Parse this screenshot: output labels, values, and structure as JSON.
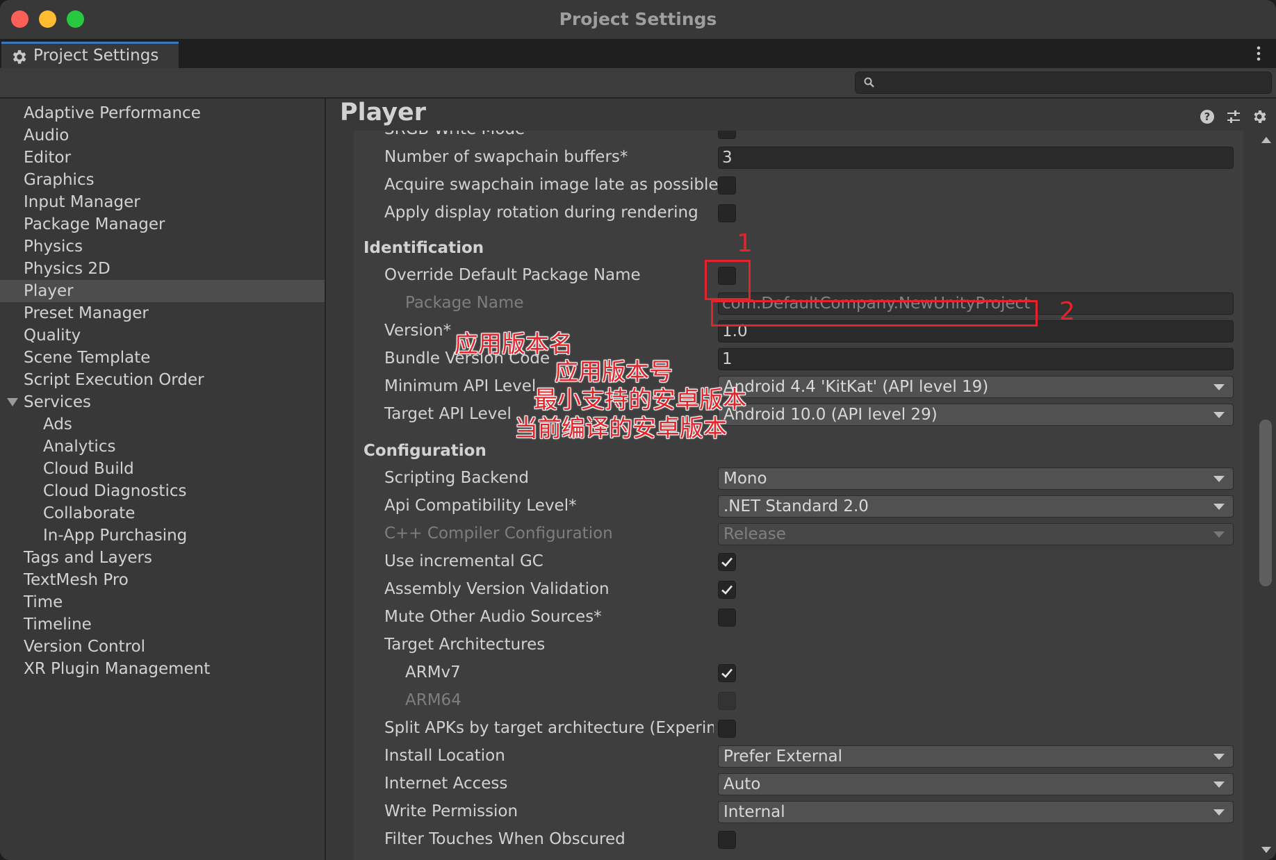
{
  "window": {
    "title": "Project Settings"
  },
  "tab": {
    "label": "Project Settings"
  },
  "search": {
    "placeholder": "",
    "value": ""
  },
  "sidebar": {
    "items": [
      {
        "label": "Adaptive Performance"
      },
      {
        "label": "Audio"
      },
      {
        "label": "Editor"
      },
      {
        "label": "Graphics"
      },
      {
        "label": "Input Manager"
      },
      {
        "label": "Package Manager"
      },
      {
        "label": "Physics"
      },
      {
        "label": "Physics 2D"
      },
      {
        "label": "Player",
        "selected": true
      },
      {
        "label": "Preset Manager"
      },
      {
        "label": "Quality"
      },
      {
        "label": "Scene Template"
      },
      {
        "label": "Script Execution Order"
      },
      {
        "label": "Services",
        "expanded": true
      },
      {
        "label": "Ads"
      },
      {
        "label": "Analytics"
      },
      {
        "label": "Cloud Build"
      },
      {
        "label": "Cloud Diagnostics"
      },
      {
        "label": "Collaborate"
      },
      {
        "label": "In-App Purchasing"
      },
      {
        "label": "Tags and Layers"
      },
      {
        "label": "TextMesh Pro"
      },
      {
        "label": "Time"
      },
      {
        "label": "Timeline"
      },
      {
        "label": "Version Control"
      },
      {
        "label": "XR Plugin Management"
      }
    ]
  },
  "panel": {
    "title": "Player",
    "rows": [
      {
        "label": "SRGB Write Mode*",
        "type": "checkbox",
        "checked": false
      },
      {
        "label": "Number of swapchain buffers*",
        "type": "field",
        "value": "3"
      },
      {
        "label": "Acquire swapchain image late as possible*",
        "type": "checkbox",
        "checked": false
      },
      {
        "label": "Apply display rotation during rendering",
        "type": "checkbox",
        "checked": false
      },
      {
        "label": "Identification",
        "type": "section"
      },
      {
        "label": "Override Default Package Name",
        "type": "checkbox",
        "checked": false
      },
      {
        "label": "Package Name",
        "type": "field",
        "value": "com.DefaultCompany.NewUnityProject",
        "disabled": true
      },
      {
        "label": "Version*",
        "type": "field",
        "value": "1.0"
      },
      {
        "label": "Bundle Version Code",
        "type": "field",
        "value": "1"
      },
      {
        "label": "Minimum API Level",
        "type": "dropdown",
        "value": "Android 4.4 'KitKat' (API level 19)"
      },
      {
        "label": "Target API Level",
        "type": "dropdown",
        "value": "Android 10.0 (API level 29)"
      },
      {
        "label": "Configuration",
        "type": "section"
      },
      {
        "label": "Scripting Backend",
        "type": "dropdown",
        "value": "Mono"
      },
      {
        "label": "Api Compatibility Level*",
        "type": "dropdown",
        "value": ".NET Standard 2.0"
      },
      {
        "label": "C++ Compiler Configuration",
        "type": "dropdown",
        "value": "Release",
        "disabled": true
      },
      {
        "label": "Use incremental GC",
        "type": "checkbox",
        "checked": true
      },
      {
        "label": "Assembly Version Validation",
        "type": "checkbox",
        "checked": true
      },
      {
        "label": "Mute Other Audio Sources*",
        "type": "checkbox",
        "checked": false
      },
      {
        "label": "Target Architectures",
        "type": "label"
      },
      {
        "label": "ARMv7",
        "type": "checkbox",
        "checked": true
      },
      {
        "label": "ARM64",
        "type": "checkbox",
        "checked": false,
        "disabled": true
      },
      {
        "label": "Split APKs by target architecture (Experimental)",
        "type": "checkbox",
        "checked": false
      },
      {
        "label": "Install Location",
        "type": "dropdown",
        "value": "Prefer External"
      },
      {
        "label": "Internet Access",
        "type": "dropdown",
        "value": "Auto"
      },
      {
        "label": "Write Permission",
        "type": "dropdown",
        "value": "Internal"
      },
      {
        "label": "Filter Touches When Obscured",
        "type": "checkbox",
        "checked": false
      }
    ]
  },
  "annotations": {
    "num1": "1",
    "num2": "2",
    "version_name": "应用版本名",
    "version_code": "应用版本号",
    "min_api": "最小支持的安卓版本",
    "target_api": "当前编译的安卓版本"
  },
  "colors": {
    "annotation": "#e3242b",
    "accent": "#3a79bb",
    "selected_bg": "#4d4d4d"
  }
}
